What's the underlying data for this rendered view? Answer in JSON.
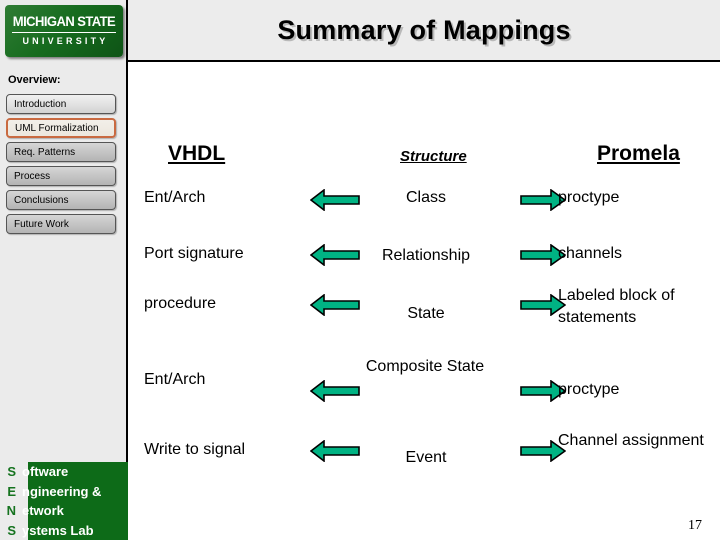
{
  "slide": {
    "title": "Summary of Mappings",
    "page_number": "17"
  },
  "sidebar": {
    "logo": {
      "line1": "MICHIGAN STATE",
      "line2": "UNIVERSITY"
    },
    "overview_label": "Overview:",
    "items": [
      {
        "label": "Introduction",
        "state": "first"
      },
      {
        "label": "UML Formalization",
        "state": "active"
      },
      {
        "label": "Req. Patterns",
        "state": "normal"
      },
      {
        "label": "Process",
        "state": "normal"
      },
      {
        "label": "Conclusions",
        "state": "normal"
      },
      {
        "label": "Future Work",
        "state": "normal"
      }
    ],
    "lab": {
      "rows": [
        {
          "initial": "S",
          "rest": "oftware"
        },
        {
          "initial": "E",
          "rest": "ngineering &"
        },
        {
          "initial": "N",
          "rest": "etwork"
        },
        {
          "initial": "S",
          "rest": "ystems Lab"
        }
      ]
    }
  },
  "main": {
    "headers": {
      "left": "VHDL",
      "middle": "Structure",
      "right": "Promela"
    },
    "rows": [
      {
        "vhdl": "Ent/Arch",
        "structure": "Class",
        "promela": "proctype",
        "left_arrow": "left-arrow-icon",
        "right_arrow": "right-arrow-icon"
      },
      {
        "vhdl": "Port signature",
        "structure": "Relationship",
        "promela": "channels",
        "left_arrow": "left-arrow-icon",
        "right_arrow": "right-arrow-icon"
      },
      {
        "vhdl": "procedure",
        "structure": "State",
        "promela": "Labeled block of statements",
        "left_arrow": "left-arrow-icon",
        "right_arrow": "right-arrow-icon"
      },
      {
        "vhdl": "Ent/Arch",
        "structure": "Composite State",
        "promela": "proctype",
        "left_arrow": "left-arrow-icon",
        "right_arrow": "right-arrow-icon"
      },
      {
        "vhdl": "Write to signal",
        "structure": "Event",
        "promela": "Channel assignment",
        "left_arrow": "left-arrow-icon",
        "right_arrow": "right-arrow-icon"
      }
    ]
  },
  "colors": {
    "arrow_fill": "#00b383",
    "arrow_stroke": "#000000",
    "msu_green": "#0d6b18",
    "active_border": "#c96a41",
    "header_bg": "#ececec",
    "sidebar_bg": "#ebebeb"
  }
}
